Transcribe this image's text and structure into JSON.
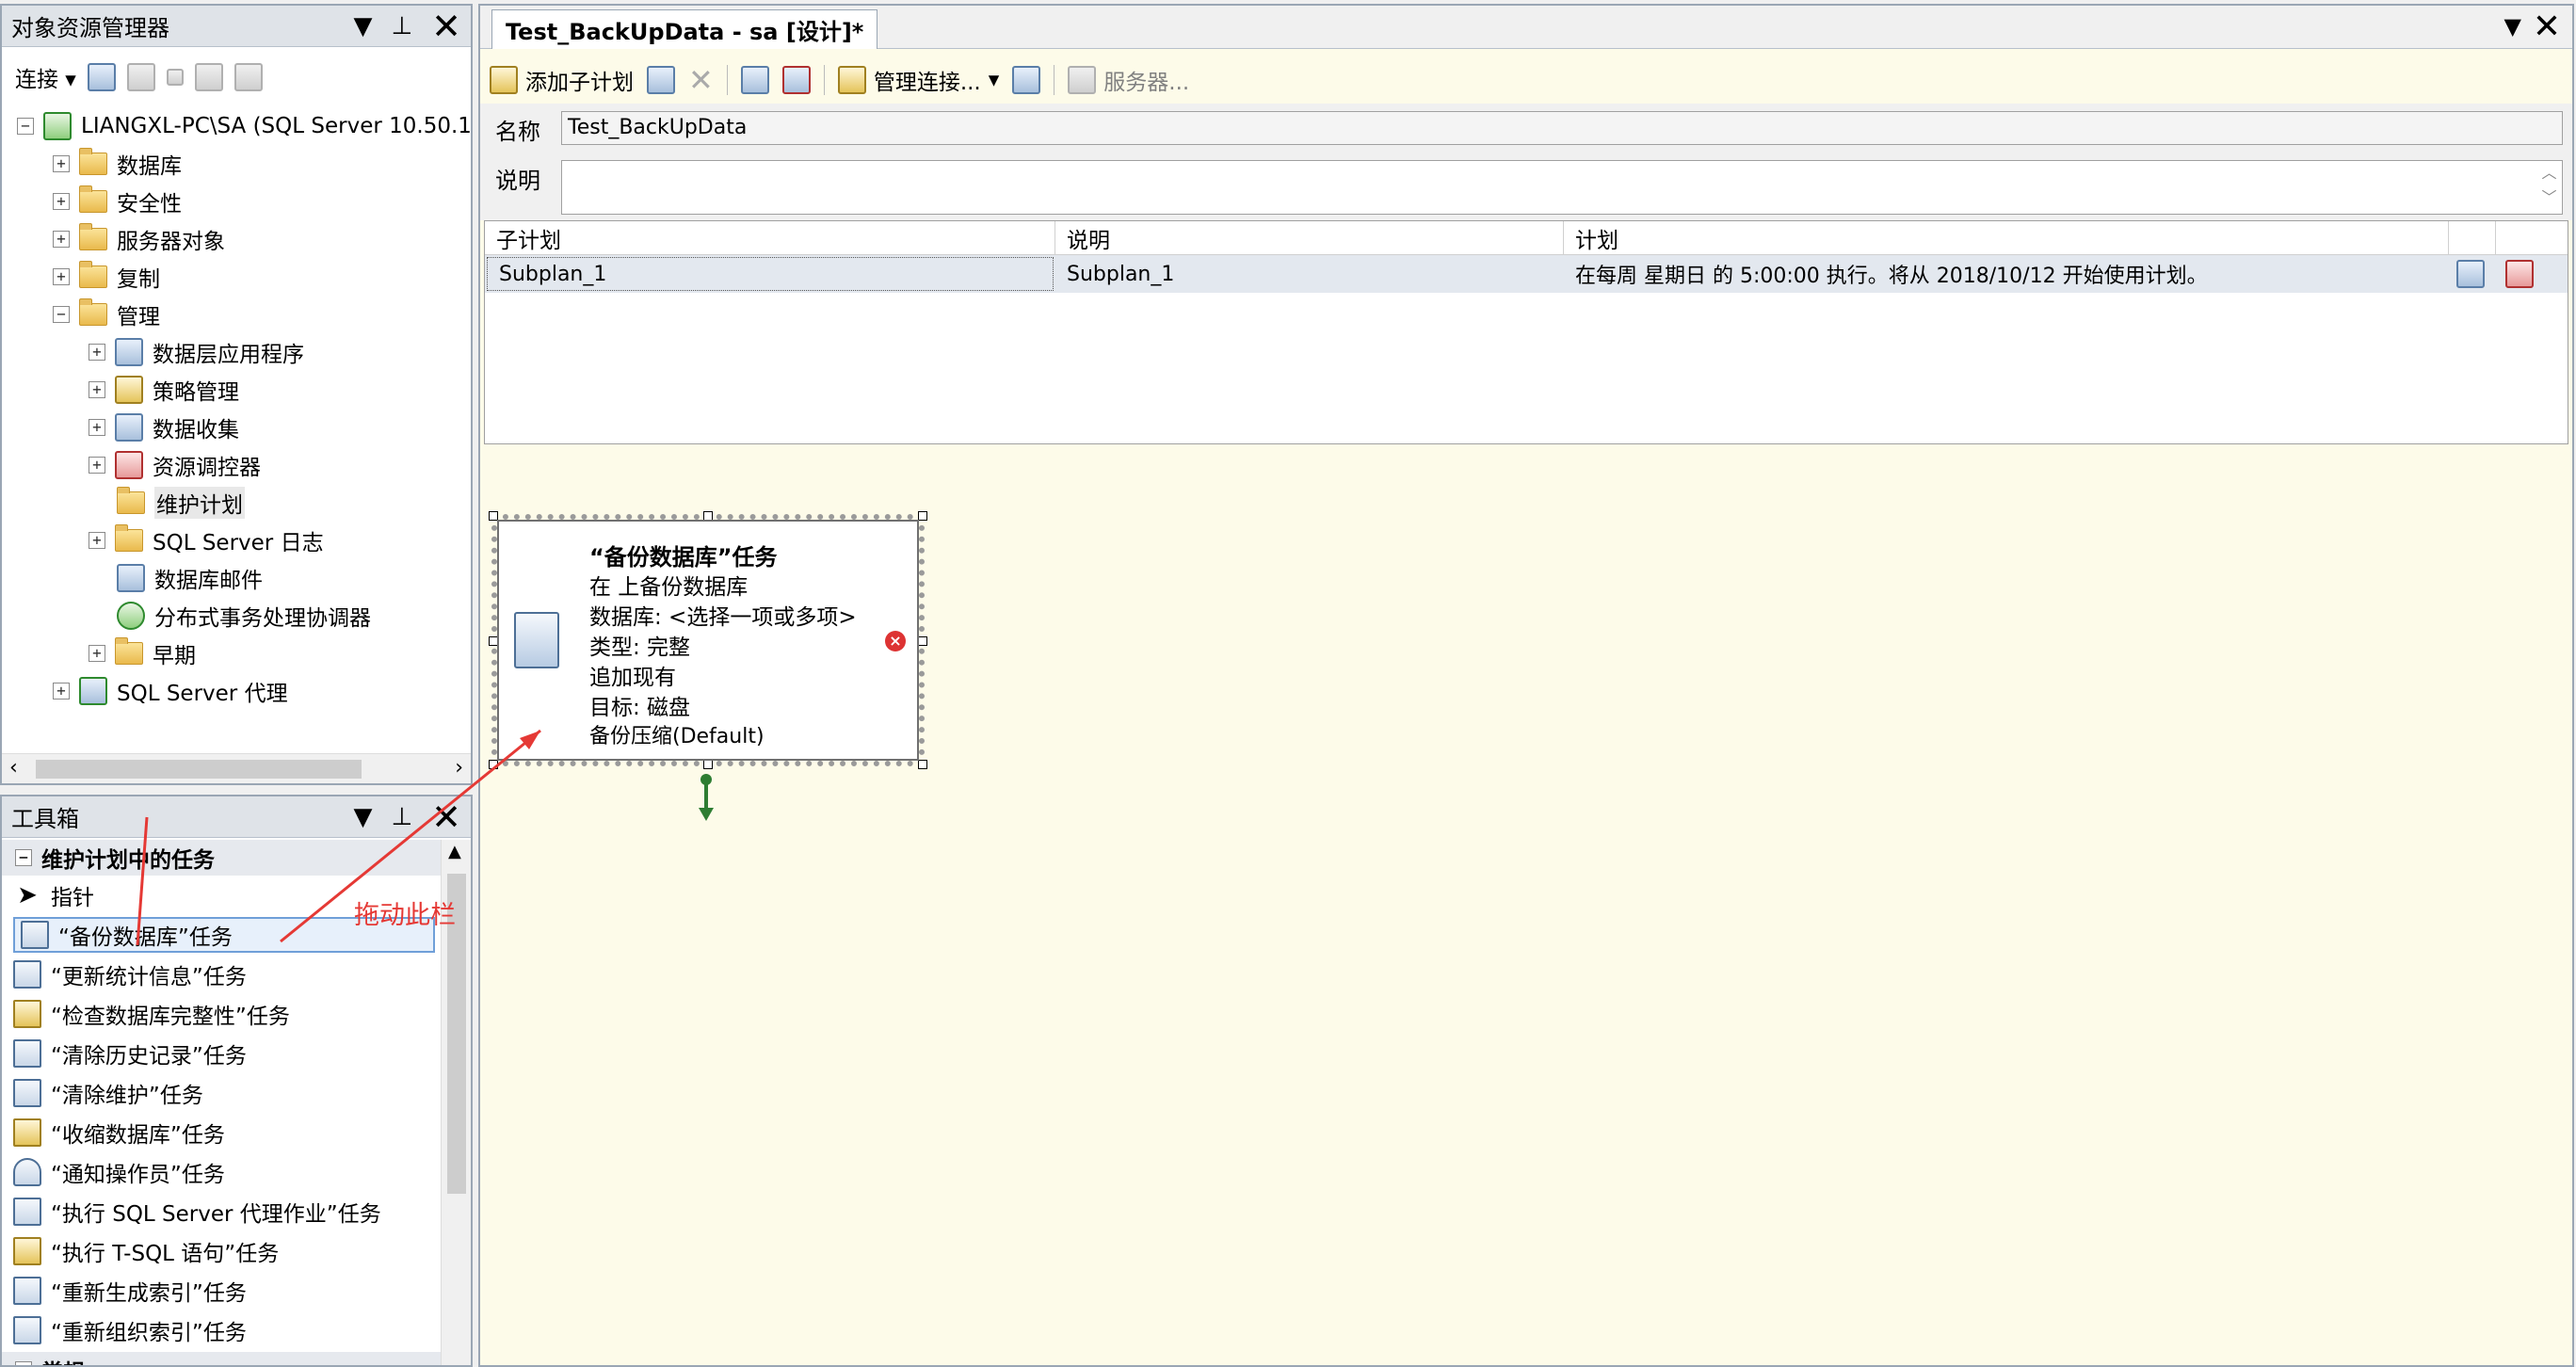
{
  "object_explorer": {
    "title": "对象资源管理器",
    "connect_label": "连接",
    "server_node": "LIANGXL-PC\\SA (SQL Server 10.50.1",
    "nodes": [
      {
        "label": "数据库",
        "level": 1
      },
      {
        "label": "安全性",
        "level": 1
      },
      {
        "label": "服务器对象",
        "level": 1
      },
      {
        "label": "复制",
        "level": 1
      },
      {
        "label": "管理",
        "level": 1
      },
      {
        "label": "数据层应用程序",
        "level": 2
      },
      {
        "label": "策略管理",
        "level": 2
      },
      {
        "label": "数据收集",
        "level": 2
      },
      {
        "label": "资源调控器",
        "level": 2
      },
      {
        "label": "维护计划",
        "level": 2
      },
      {
        "label": "SQL Server 日志",
        "level": 2
      },
      {
        "label": "数据库邮件",
        "level": 2
      },
      {
        "label": "分布式事务处理协调器",
        "level": 2
      },
      {
        "label": "早期",
        "level": 2
      },
      {
        "label": "SQL Server 代理",
        "level": 1
      }
    ]
  },
  "toolbox": {
    "title": "工具箱",
    "section_title": "维护计划中的任务",
    "items": [
      "指针",
      "“备份数据库”任务",
      "“更新统计信息”任务",
      "“检查数据库完整性”任务",
      "“清除历史记录”任务",
      "“清除维护”任务",
      "“收缩数据库”任务",
      "“通知操作员”任务",
      "“执行 SQL Server 代理作业”任务",
      "“执行 T-SQL 语句”任务",
      "“重新生成索引”任务",
      "“重新组织索引”任务"
    ],
    "next_section": "常规"
  },
  "annotation": {
    "text": "拖动此栏",
    "color": "#e53935"
  },
  "designer": {
    "tab_title": "Test_BackUpData - sa [设计]*",
    "toolbar": {
      "add_subplan": "添加子计划",
      "manage_connections": "管理连接...",
      "servers": "服务器..."
    },
    "name_label": "名称",
    "name_value": "Test_BackUpData",
    "desc_label": "说明",
    "desc_value": "",
    "grid": {
      "headers": [
        "子计划",
        "说明",
        "计划"
      ],
      "rows": [
        {
          "subplan": "Subplan_1",
          "description": "Subplan_1",
          "schedule": "在每周 星期日 的 5:00:00 执行。将从 2018/10/12 开始使用计划。"
        }
      ]
    },
    "task_box": {
      "title": "“备份数据库”任务",
      "lines": [
        "在 上备份数据库",
        "数据库: <选择一项或多项>",
        "类型: 完整",
        "追加现有",
        "目标: 磁盘",
        "备份压缩(Default)"
      ]
    },
    "canvas_color": "#fdfbe9"
  }
}
